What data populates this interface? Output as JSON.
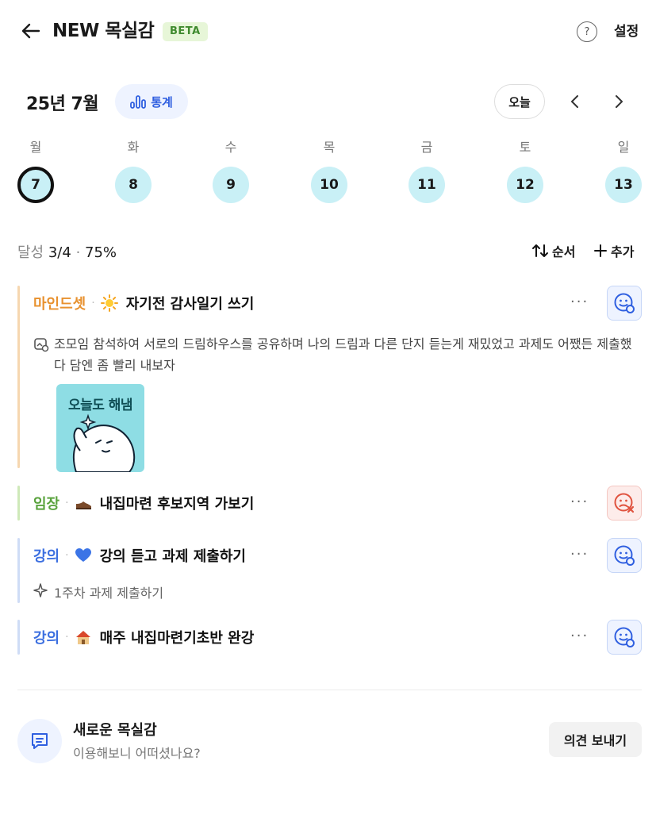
{
  "header": {
    "title": "NEW 목실감",
    "badge": "BETA",
    "help_icon": "question-circle-icon",
    "settings_label": "설정"
  },
  "calendar": {
    "month_label": "25년 7월",
    "stats_label": "통계",
    "today_label": "오늘",
    "weekdays": [
      "월",
      "화",
      "수",
      "목",
      "금",
      "토",
      "일"
    ],
    "days": [
      "7",
      "8",
      "9",
      "10",
      "11",
      "12",
      "13"
    ],
    "selected_index": 0,
    "day_color": "#c9f0f6"
  },
  "progress": {
    "label": "달성",
    "count": "3/4",
    "sep": "·",
    "percent": "75%",
    "sort_label": "순서",
    "add_label": "추가"
  },
  "items": [
    {
      "category": "마인드셋",
      "category_color": "#e8912e",
      "bar_color": "#f6d7b0",
      "emoji_icon": "sun-icon",
      "task": "자기전 감사일기 쓰기",
      "status": "done",
      "note_icon": "memo-image-icon",
      "note": "조모임 참석하여 서로의 드림하우스를 공유하며 나의 드림과 다른 단지 듣는게 재밌었고 과제도 어쨌든 제출했다 담엔 좀 빨리 내보자",
      "sticker_text": "오늘도 해냄"
    },
    {
      "category": "임장",
      "category_color": "#5aa33e",
      "bar_color": "#cfe9b9",
      "emoji_icon": "shoe-icon",
      "task": "내집마련 후보지역 가보기",
      "status": "fail"
    },
    {
      "category": "강의",
      "category_color": "#3c6fe0",
      "bar_color": "#cfdcf6",
      "emoji_icon": "blue-heart-icon",
      "task": "강의 듣고 과제 제출하기",
      "status": "done",
      "sub_icon": "sparkle-icon",
      "sub": "1주차 과제 제출하기"
    },
    {
      "category": "강의",
      "category_color": "#3c6fe0",
      "bar_color": "#cfdcf6",
      "emoji_icon": "house-icon",
      "task": "매주 내집마련기초반 완강",
      "status": "done"
    }
  ],
  "feedback": {
    "title": "새로운 목실감",
    "subtitle": "이용해보니 어떠셨나요?",
    "button": "의견 보내기"
  }
}
